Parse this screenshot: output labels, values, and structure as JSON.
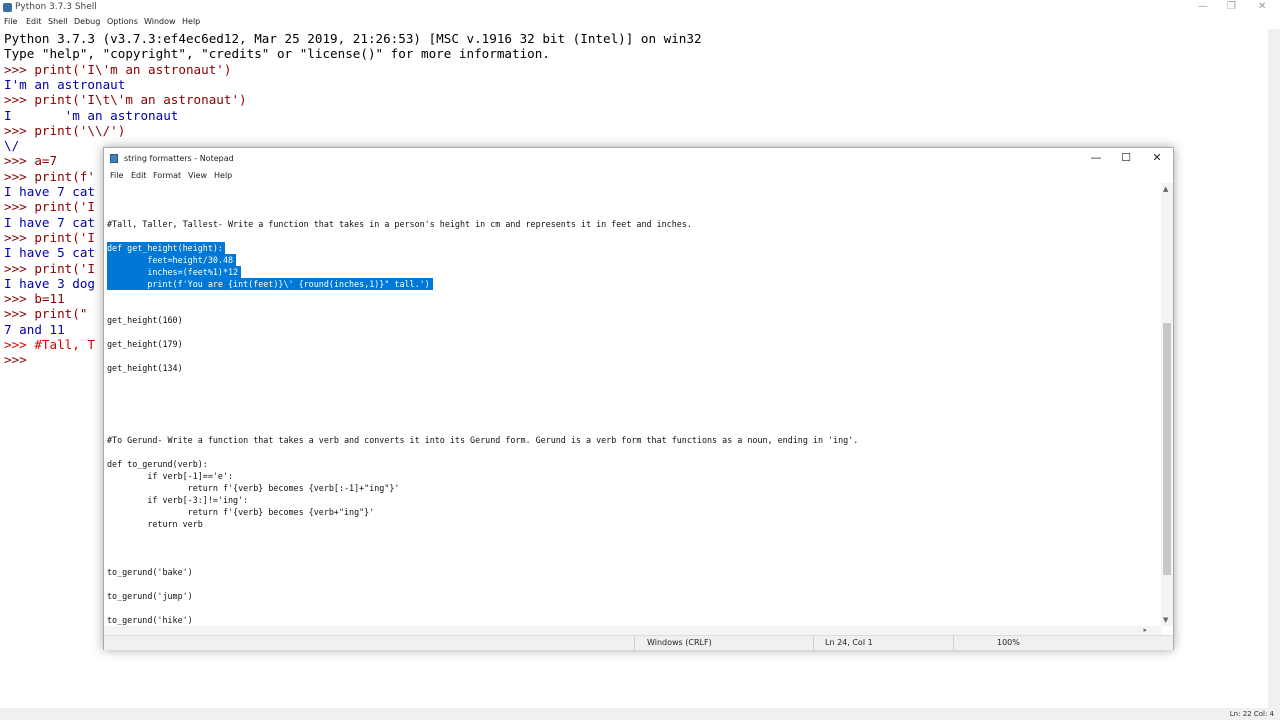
{
  "shell": {
    "title": "Python 3.7.3 Shell",
    "menu": [
      "File",
      "Edit",
      "Shell",
      "Debug",
      "Options",
      "Window",
      "Help"
    ],
    "lines": [
      {
        "text": "Python 3.7.3 (v3.7.3:ef4ec6ed12, Mar 25 2019, 21:26:53) [MSC v.1916 32 bit (Intel)] on win32",
        "kind": "black"
      },
      {
        "text": "Type \"help\", \"copyright\", \"credits\" or \"license()\" for more information.",
        "kind": "black"
      },
      {
        "text": ">>> print('I\\'m an astronaut')",
        "kind": "prompt"
      },
      {
        "text": "I'm an astronaut",
        "kind": "out"
      },
      {
        "text": ">>> print('I\\t\\'m an astronaut')",
        "kind": "prompt"
      },
      {
        "text": "I       'm an astronaut",
        "kind": "out"
      },
      {
        "text": ">>> print('\\\\/')",
        "kind": "prompt"
      },
      {
        "text": "\\/",
        "kind": "out"
      },
      {
        "text": ">>> a=7",
        "kind": "prompt"
      },
      {
        "text": ">>> print(f'",
        "kind": "prompt"
      },
      {
        "text": "I have 7 cat",
        "kind": "out"
      },
      {
        "text": ">>> print('I",
        "kind": "prompt"
      },
      {
        "text": "I have 7 cat",
        "kind": "out"
      },
      {
        "text": ">>> print('I",
        "kind": "prompt"
      },
      {
        "text": "I have 5 cat",
        "kind": "out"
      },
      {
        "text": ">>> print('I",
        "kind": "prompt"
      },
      {
        "text": "I have 3 dog",
        "kind": "out"
      },
      {
        "text": ">>> b=11",
        "kind": "prompt"
      },
      {
        "text": ">>> print(\"",
        "kind": "prompt"
      },
      {
        "text": "7 and 11",
        "kind": "out"
      },
      {
        "text": ">>> #Tall, T",
        "kind": "comment"
      },
      {
        "text": ">>> ",
        "kind": "prompt"
      }
    ],
    "status": "Ln: 22  Col: 4",
    "window_controls": {
      "minimize": "—",
      "restore": "❐",
      "close": "✕"
    }
  },
  "notepad": {
    "title": "string formatters - Notepad",
    "menu": [
      "File",
      "Edit",
      "Format",
      "View",
      "Help"
    ],
    "controls": {
      "minimize": "—",
      "maximize": "☐",
      "close": "✕"
    },
    "lines": [
      {
        "text": "#Tall, Taller, Tallest- Write a function that takes in a person's height in cm and represents it in feet and inches.",
        "row": 0,
        "sel": false
      },
      {
        "text": "def get_height(height):",
        "row": 2,
        "sel": true
      },
      {
        "text": "        feet=height/30.48",
        "row": 3,
        "sel": true
      },
      {
        "text": "        inches=(feet%1)*12",
        "row": 4,
        "sel": true
      },
      {
        "text": "        print(f'You are {int(feet)}\\' {round(inches,1)}\" tall.')",
        "row": 5,
        "sel": true
      },
      {
        "text": "get_height(160)",
        "row": 8,
        "sel": false
      },
      {
        "text": "get_height(179)",
        "row": 10,
        "sel": false
      },
      {
        "text": "get_height(134)",
        "row": 12,
        "sel": false
      },
      {
        "text": "#To Gerund- Write a function that takes a verb and converts it into its Gerund form. Gerund is a verb form that functions as a noun, ending in 'ing'.",
        "row": 18,
        "sel": false
      },
      {
        "text": "def to_gerund(verb):",
        "row": 20,
        "sel": false
      },
      {
        "text": "        if verb[-1]=='e':",
        "row": 21,
        "sel": false
      },
      {
        "text": "                return f'{verb} becomes {verb[:-1]+\"ing\"}'",
        "row": 22,
        "sel": false
      },
      {
        "text": "        if verb[-3:]!='ing':",
        "row": 23,
        "sel": false
      },
      {
        "text": "                return f'{verb} becomes {verb+\"ing\"}'",
        "row": 24,
        "sel": false
      },
      {
        "text": "        return verb",
        "row": 25,
        "sel": false
      },
      {
        "text": "to_gerund('bake')",
        "row": 29,
        "sel": false
      },
      {
        "text": "to_gerund('jump')",
        "row": 31,
        "sel": false
      },
      {
        "text": "to_gerund('hike')",
        "row": 33,
        "sel": false
      }
    ],
    "status": {
      "encoding": "Windows (CRLF)",
      "position": "Ln 24, Col 1",
      "zoom": "100%"
    }
  }
}
